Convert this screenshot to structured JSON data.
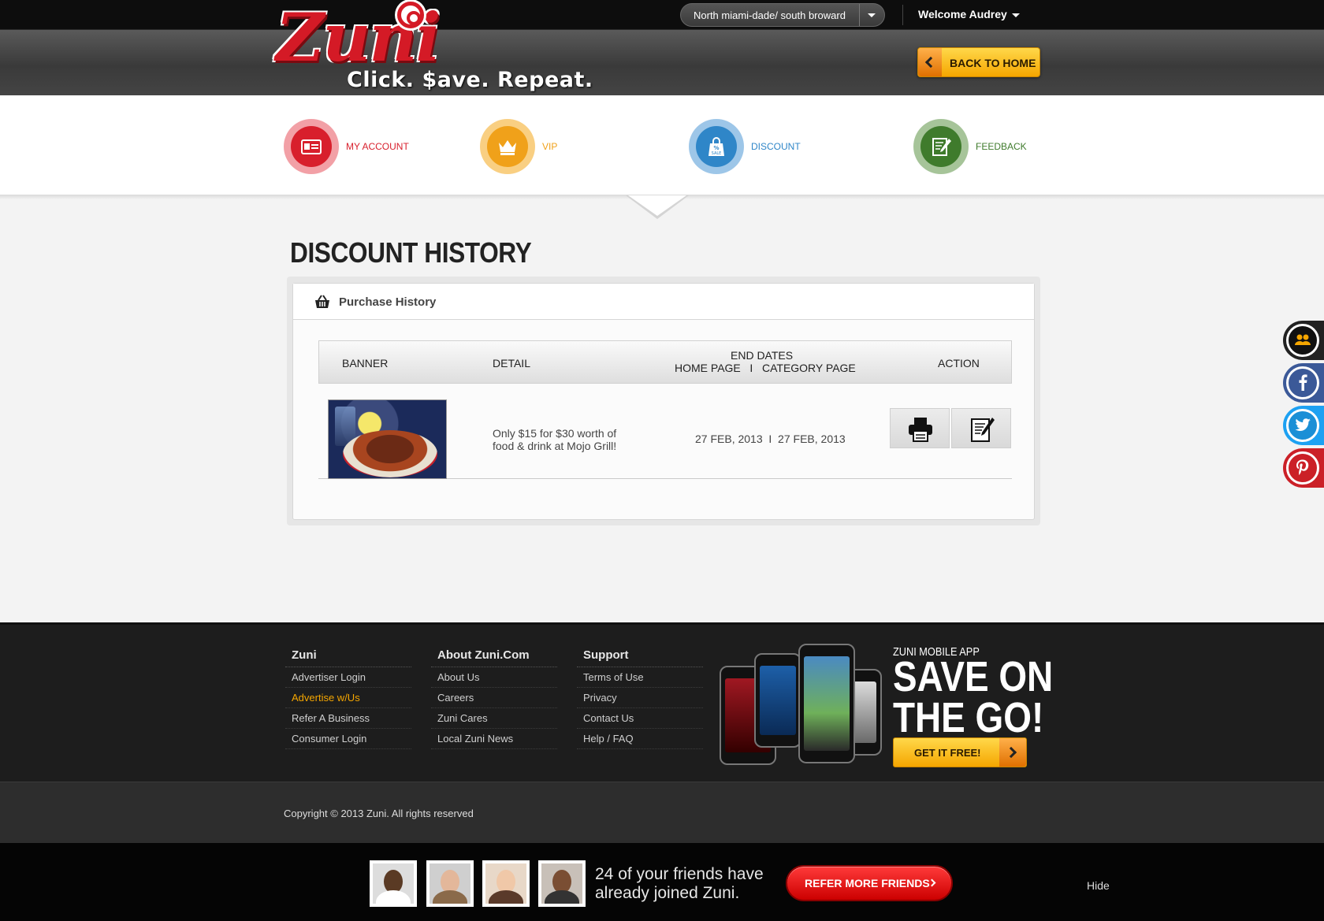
{
  "brand": {
    "logo_text": "Zuni",
    "tagline": "Click. $ave. Repeat.",
    "accent": "#d41a26"
  },
  "header": {
    "region": "North miami-dade/ south broward",
    "welcome": "Welcome Audrey",
    "back_home": "BACK TO HOME"
  },
  "categories": [
    {
      "label": "MY ACCOUNT",
      "icon": "id-card-icon",
      "color": "#d81f2c"
    },
    {
      "label": "VIP",
      "icon": "crown-icon",
      "color": "#f0a11a"
    },
    {
      "label": "DISCOUNT",
      "icon": "sale-bag-icon",
      "color": "#2f86c8"
    },
    {
      "label": "FEEDBACK",
      "icon": "notepad-pen-icon",
      "color": "#3f7b2c"
    }
  ],
  "page": {
    "title": "DISCOUNT HISTORY",
    "panel_title": "Purchase History",
    "table": {
      "headers": {
        "banner": "BANNER",
        "detail": "DETAIL",
        "end_dates": "END DATES",
        "end_dates_sub": "HOME PAGE   I   CATEGORY PAGE",
        "action": "ACTION"
      },
      "rows": [
        {
          "detail": "Only $15 for $30 worth of food & drink at Mojo Grill!",
          "dates": "27 FEB, 2013  I  27 FEB, 2013",
          "actions": [
            "print-icon",
            "edit-icon"
          ]
        }
      ]
    }
  },
  "social": [
    "friends-icon",
    "facebook-icon",
    "twitter-icon",
    "pinterest-icon"
  ],
  "footer": {
    "columns": [
      {
        "heading": "Zuni",
        "links": [
          "Advertiser Login",
          "Advertise w/Us",
          "Refer A Business",
          "Consumer Login"
        ]
      },
      {
        "heading": "About Zuni.Com",
        "links": [
          "About Us",
          "Careers",
          "Zuni Cares",
          "Local Zuni News"
        ]
      },
      {
        "heading": "Support",
        "links": [
          "Terms of Use",
          "Privacy",
          "Contact Us",
          "Help / FAQ"
        ]
      }
    ],
    "app": {
      "kicker": "ZUNI MOBILE APP",
      "headline_1": "SAVE ON",
      "headline_2": "THE GO!",
      "cta": "GET IT FREE!"
    },
    "copyright": "Copyright © 2013 Zuni. All rights reserved"
  },
  "referral": {
    "text": "24 of your friends have already joined Zuni.",
    "button": "REFER MORE FRIENDS",
    "hide": "Hide"
  }
}
